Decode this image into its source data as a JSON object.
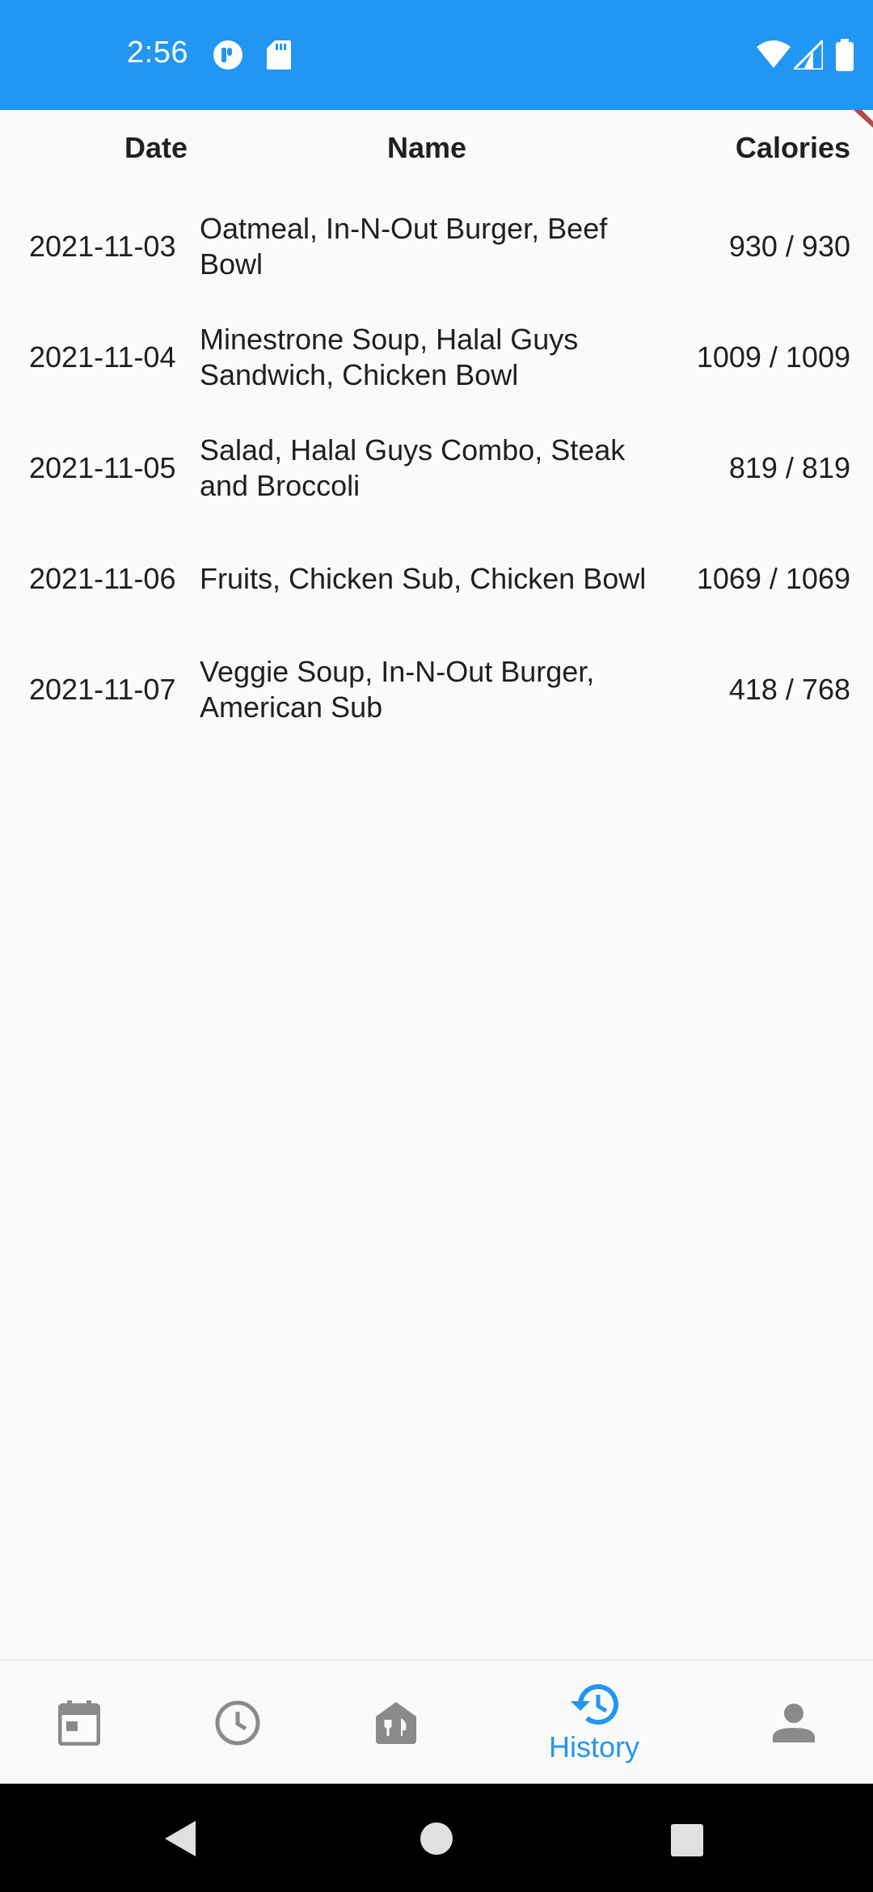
{
  "status_bar": {
    "time": "2:56",
    "color": "#2196f3"
  },
  "table": {
    "headers": {
      "date": "Date",
      "name": "Name",
      "calories": "Calories"
    },
    "rows": [
      {
        "date": "2021-11-03",
        "name": "Oatmeal, In-N-Out Burger, Beef Bowl",
        "calories": "930 / 930"
      },
      {
        "date": "2021-11-04",
        "name": "Minestrone Soup, Halal Guys Sandwich, Chicken Bowl",
        "calories": "1009 / 1009"
      },
      {
        "date": "2021-11-05",
        "name": "Salad, Halal Guys Combo, Steak and Broccoli",
        "calories": "819 / 819"
      },
      {
        "date": "2021-11-06",
        "name": "Fruits, Chicken Sub, Chicken Bowl",
        "calories": "1069 / 1069"
      },
      {
        "date": "2021-11-07",
        "name": "Veggie Soup, In-N-Out Burger, American Sub",
        "calories": "418 / 768"
      }
    ]
  },
  "bottom_nav": {
    "items": [
      {
        "icon": "calendar-icon",
        "label": "",
        "active": false
      },
      {
        "icon": "clock-icon",
        "label": "",
        "active": false
      },
      {
        "icon": "restaurant-icon",
        "label": "",
        "active": false
      },
      {
        "icon": "history-icon",
        "label": "History",
        "active": true
      },
      {
        "icon": "person-icon",
        "label": "",
        "active": false
      }
    ],
    "active_color": "#2196f3",
    "inactive_color": "#8a8a8a"
  },
  "system_nav": {
    "buttons": [
      "back",
      "home",
      "recents"
    ]
  }
}
